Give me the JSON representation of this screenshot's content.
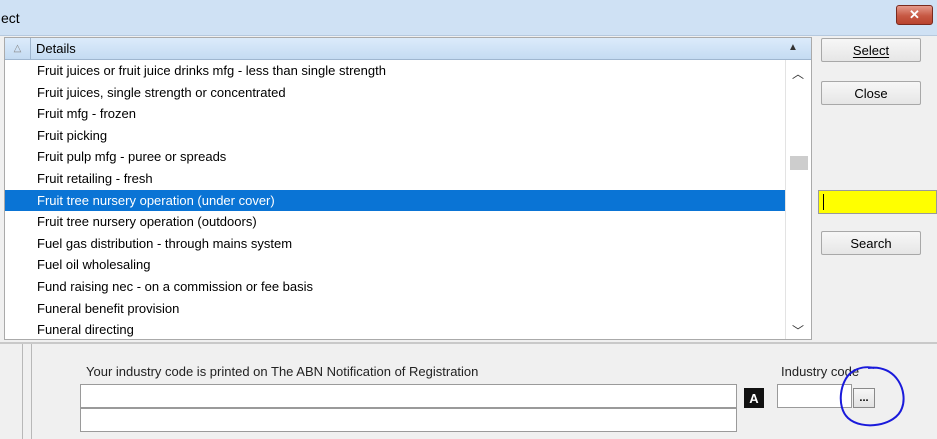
{
  "window": {
    "title": "ect",
    "close_label": "✕"
  },
  "list": {
    "header": {
      "column_label": "Details",
      "sort_icon": "sort-up-icon"
    },
    "rows": [
      "Fruit juices or fruit juice drinks mfg - less than single strength",
      "Fruit juices, single strength or concentrated",
      "Fruit mfg - frozen",
      "Fruit picking",
      "Fruit pulp mfg - puree or spreads",
      "Fruit retailing - fresh",
      "Fruit tree nursery operation (under cover)",
      "Fruit tree nursery operation (outdoors)",
      "Fuel gas distribution - through mains system",
      "Fuel oil wholesaling",
      "Fund raising nec - on a commission or fee basis",
      "Funeral benefit provision",
      "Funeral directing"
    ],
    "selected_index": 6
  },
  "buttons": {
    "select_label": "Select",
    "close_label": "Close",
    "search_label": "Search"
  },
  "search": {
    "value": ""
  },
  "bottom": {
    "info_text": "Your industry code is printed on The ABN Notification of Registration",
    "industry_code_label": "Industry code",
    "a_badge": "A",
    "lookup_label": "..."
  },
  "colors": {
    "selection": "#0a74d5",
    "search_bg": "#ffff00",
    "annotation": "#1a1adb"
  }
}
